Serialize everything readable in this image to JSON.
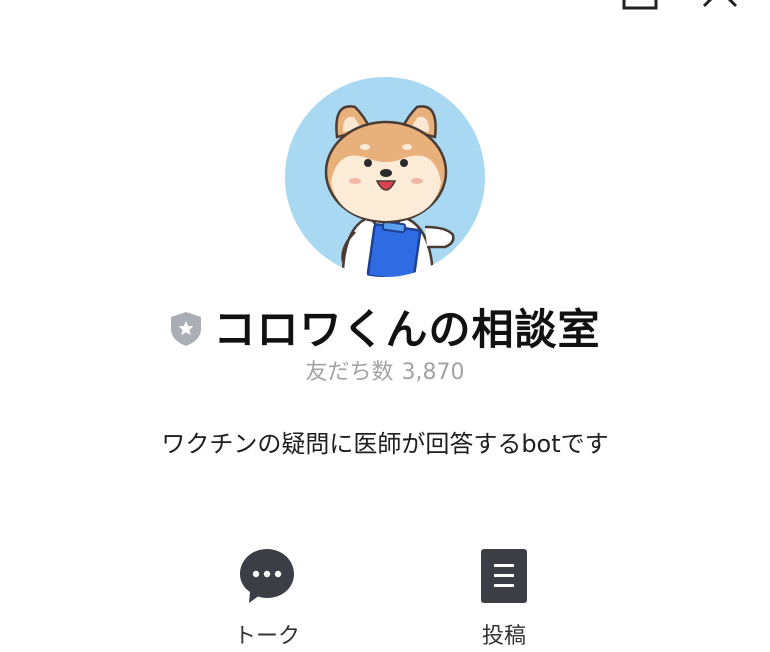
{
  "header": {
    "share_icon": "share-icon",
    "close_icon": "close-icon"
  },
  "profile": {
    "avatar": "shiba-doctor-avatar",
    "badge_icon": "shield-star-icon",
    "name": "コロワくんの相談室",
    "friends_label": "友だち数",
    "friends_count": "3,870",
    "description": "ワクチンの疑問に医師が回答するbotです"
  },
  "actions": {
    "talk": {
      "label": "トーク",
      "icon": "chat-bubble-icon"
    },
    "post": {
      "label": "投稿",
      "icon": "document-icon"
    }
  },
  "colors": {
    "avatar_bg": "#a9d9f2",
    "badge": "#a9aeb5",
    "icon_dark": "#3b3f45",
    "muted_text": "#a3a3a3"
  }
}
